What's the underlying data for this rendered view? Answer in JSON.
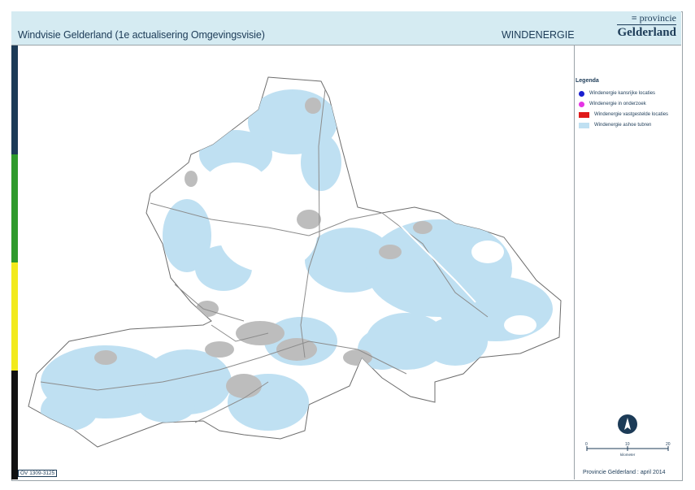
{
  "header": {
    "title": "Windvisie Gelderland (1e actualisering Omgevingsvisie)",
    "theme": "WINDENERGIE"
  },
  "logo": {
    "line1": "≡ provincie",
    "line2": "Gelderland"
  },
  "stripes": [
    {
      "name": "stripe-dark-blue",
      "color": "#1c3b57"
    },
    {
      "name": "stripe-green",
      "color": "#2f9a2c"
    },
    {
      "name": "stripe-yellow",
      "color": "#f2ea1c"
    },
    {
      "name": "stripe-black",
      "color": "#111111"
    }
  ],
  "legend": {
    "title": "Legenda",
    "items": [
      {
        "label": "Windenergie kansrijke locaties",
        "color": "#1a1fd0",
        "symbol": "dot"
      },
      {
        "label": "Windenergie in onderzoek",
        "color": "#e535e5",
        "symbol": "dot"
      },
      {
        "label": "Windenergie vastgestelde locaties",
        "color": "#e01a1a",
        "symbol": "rect"
      },
      {
        "label": "Windenergie ashoe tubren",
        "color": "#bfe0f2",
        "symbol": "rect"
      }
    ]
  },
  "scale": {
    "ticks": [
      "0",
      "10",
      "20"
    ],
    "unit": "kilometer"
  },
  "credit": "Provincie Gelderland : april 2014",
  "map_code": "OV 1309-3125",
  "colors": {
    "land": "#ffffff",
    "wind_area": "#bfe0f2",
    "urban": "#bdbdbd",
    "road": "#8c8c8c",
    "outline": "#6d6d6d"
  }
}
